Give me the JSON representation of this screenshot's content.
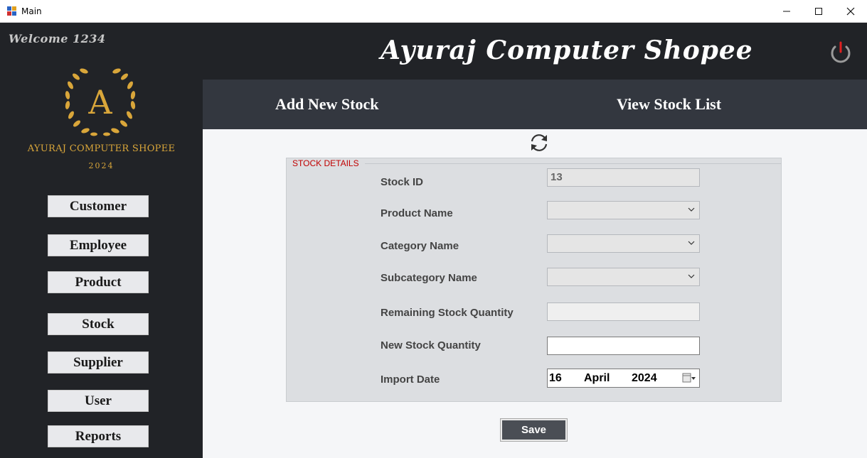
{
  "window": {
    "title": "Main",
    "icons": {
      "app": "app-icon",
      "minimize": "minimize-icon",
      "maximize": "maximize-icon",
      "close": "close-icon"
    }
  },
  "sidebar": {
    "welcome": "Welcome 1234",
    "logo_letter": "A",
    "brand_name": "AYURAJ COMPUTER SHOPEE",
    "brand_year": "2024",
    "nav": [
      {
        "label": "Customer"
      },
      {
        "label": "Employee"
      },
      {
        "label": "Product"
      },
      {
        "label": "Stock"
      },
      {
        "label": "Supplier"
      },
      {
        "label": "User"
      },
      {
        "label": "Reports"
      }
    ]
  },
  "header": {
    "title": "Ayuraj Computer Shopee",
    "power_icon": "power-icon"
  },
  "tabs": {
    "add": "Add New Stock",
    "view": "View Stock List"
  },
  "form": {
    "refresh_icon": "refresh-icon",
    "group_title": "STOCK DETAILS",
    "stock_id": {
      "label": "Stock ID",
      "value": "13"
    },
    "product_name": {
      "label": "Product Name",
      "value": ""
    },
    "category_name": {
      "label": "Category Name",
      "value": ""
    },
    "subcategory_name": {
      "label": "Subcategory Name",
      "value": ""
    },
    "remaining_qty": {
      "label": "Remaining Stock Quantity",
      "value": ""
    },
    "new_qty": {
      "label": "New Stock Quantity",
      "value": ""
    },
    "import_date": {
      "label": "Import Date",
      "day": "16",
      "month": "April",
      "year": "2024"
    },
    "save_label": "Save"
  },
  "colors": {
    "dark_bg": "#212327",
    "tab_bg": "#33373f",
    "gold": "#d9a63a",
    "legend_red": "#c00000",
    "power_red": "#e02020"
  }
}
